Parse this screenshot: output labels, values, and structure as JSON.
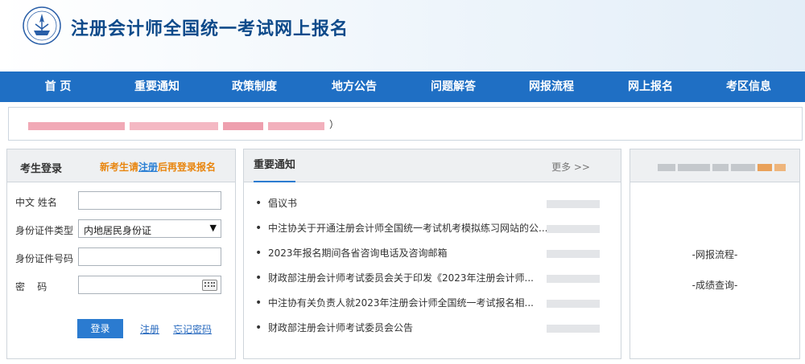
{
  "header": {
    "title": "注册会计师全国统一考试网上报名"
  },
  "nav": {
    "items": [
      "首 页",
      "重要通知",
      "政策制度",
      "地方公告",
      "问题解答",
      "网报流程",
      "网上报名",
      "考区信息"
    ]
  },
  "banner": {
    "visible_text": "）"
  },
  "login": {
    "title": "考生登录",
    "hint_before": "新考生请",
    "hint_link": "注册",
    "hint_after": "后再登录报名",
    "labels": {
      "name": "中文 姓名",
      "id_type": "身份证件类型",
      "id_number": "身份证件号码",
      "password": "密    码"
    },
    "id_type_selected": "内地居民身份证",
    "login_button": "登录",
    "register_link": "注册",
    "forgot_link": "忘记密码"
  },
  "notices": {
    "title": "重要通知",
    "more": "更多 >>",
    "items": [
      "倡议书",
      "中注协关于开通注册会计师全国统一考试机考模拟练习网站的公...",
      "2023年报名期间各省咨询电话及咨询邮箱",
      "财政部注册会计师考试委员会关于印发《2023年注册会计师...",
      "中注协有关负责人就2023年注册会计师全国统一考试报名相...",
      "财政部注册会计师考试委员会公告"
    ]
  },
  "side": {
    "links": [
      "-网报流程-",
      "-成绩查询-"
    ]
  },
  "colors": {
    "nav_bg": "#1f6fc4",
    "title": "#0e4a8a",
    "hint": "#e8850e",
    "button": "#2b7bd0"
  }
}
